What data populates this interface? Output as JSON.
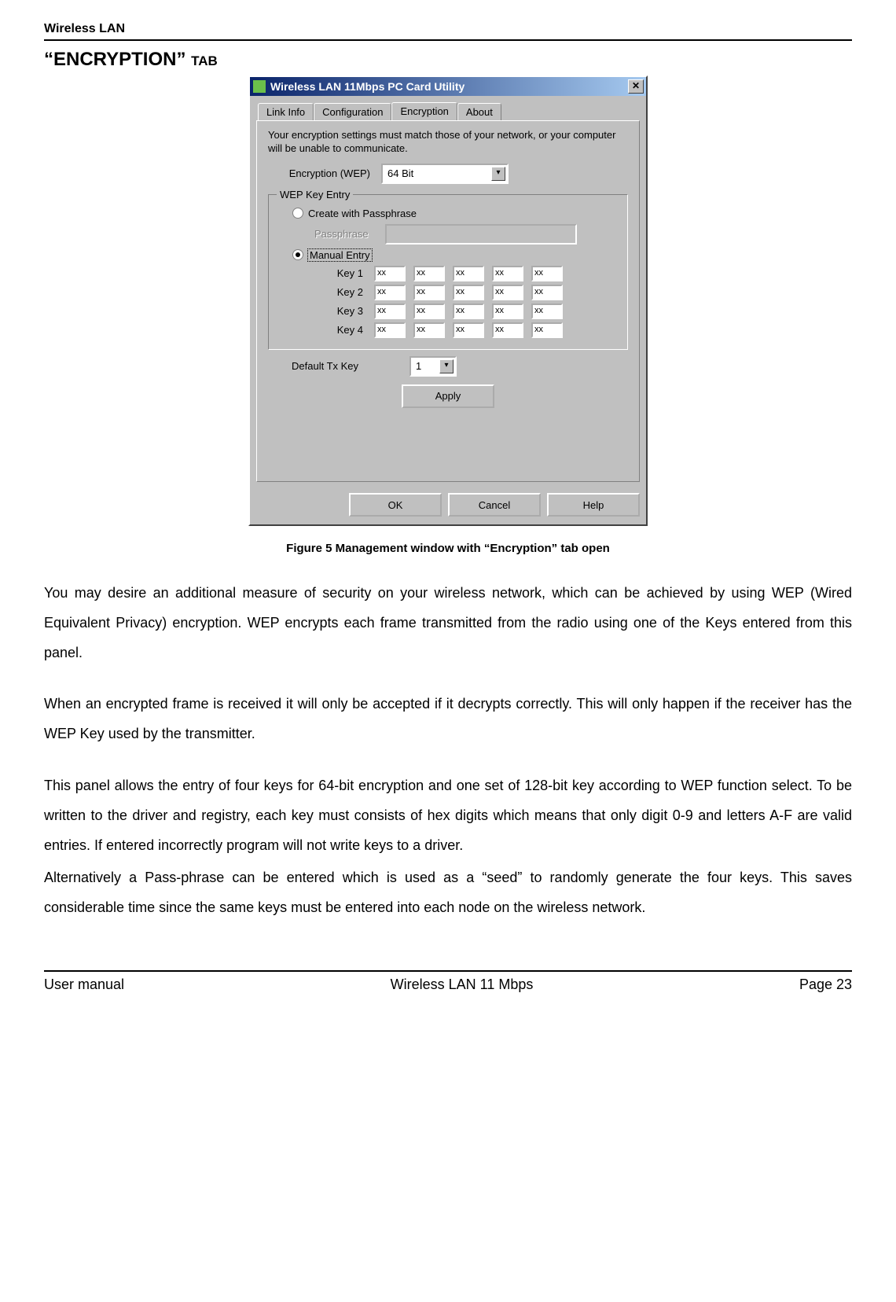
{
  "header": "Wireless LAN",
  "sectionTitle": "“ENCRYPTION” tab",
  "dialog": {
    "title": "Wireless LAN 11Mbps PC Card Utility",
    "tabs": [
      "Link Info",
      "Configuration",
      "Encryption",
      "About"
    ],
    "activeTab": "Encryption",
    "intro": "Your encryption settings must match those of your network, or your computer will be unable to communicate.",
    "wepLabel": "Encryption (WEP)",
    "wepValue": "64 Bit",
    "groupTitle": "WEP Key Entry",
    "radioPassphrase": "Create with Passphrase",
    "passLabel": "Passphrase",
    "radioManual": "Manual Entry",
    "keys": [
      {
        "label": "Key 1",
        "cells": [
          "xx",
          "xx",
          "xx",
          "xx",
          "xx"
        ]
      },
      {
        "label": "Key 2",
        "cells": [
          "xx",
          "xx",
          "xx",
          "xx",
          "xx"
        ]
      },
      {
        "label": "Key 3",
        "cells": [
          "xx",
          "xx",
          "xx",
          "xx",
          "xx"
        ]
      },
      {
        "label": "Key 4",
        "cells": [
          "xx",
          "xx",
          "xx",
          "xx",
          "xx"
        ]
      }
    ],
    "defaultTxLabel": "Default Tx Key",
    "defaultTxValue": "1",
    "applyLabel": "Apply",
    "okLabel": "OK",
    "cancelLabel": "Cancel",
    "helpLabel": "Help"
  },
  "figureCaption": "Figure 5  Management window with “Encryption” tab open",
  "para1": "You may desire an additional measure of security on your wireless network, which can be achieved by using WEP (Wired Equivalent Privacy) encryption.  WEP encrypts each frame transmitted from the radio using one of the Keys entered from this panel.",
  "para2": "When an encrypted frame is received it will only be accepted if it decrypts correctly.  This will only happen if the receiver has the WEP Key used by the transmitter.",
  "para3": "This panel allows the entry of four keys for 64-bit encryption and one set of 128-bit key according to WEP function select. To be written to the driver and registry, each key must consists of hex digits which means that only digit 0-9 and letters A-F are valid entries. If entered incorrectly program will not write keys to a driver.",
  "para4": "Alternatively a Pass-phrase can be entered which is used as a “seed” to randomly generate the four keys.  This saves considerable time since the same keys must be entered into each node on the wireless network.",
  "footer": {
    "left": "User manual",
    "center": "Wireless LAN 11 Mbps",
    "right": "Page 23"
  }
}
